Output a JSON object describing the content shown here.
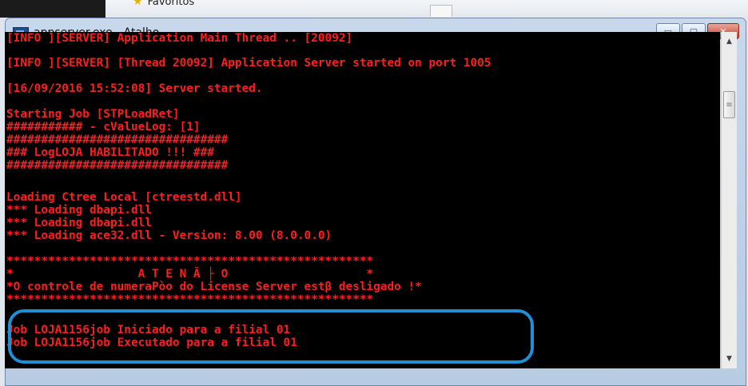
{
  "background": {
    "favorites_label": "Favoritos"
  },
  "window": {
    "title": "appserver.exe - Atalho",
    "controls": {
      "minimize": "▭",
      "maximize": "▢",
      "close": "✕"
    }
  },
  "console": {
    "lines": [
      "[INFO ][SERVER] Application Main Thread .. [20092]",
      "[INFO ][SERVER] [Thread 20092] Application Server started on port 1005",
      "[16/09/2016 15:52:08] Server started.",
      "Starting Job [STPLoadRet]",
      "########### - cValueLog: [1]",
      "################################",
      "### LogLOJA HABILITADO !!! ###",
      "################################",
      "Loading Ctree Local [ctreestd.dll]",
      "*** Loading dbapi.dll",
      "*** Loading dbapi.dll",
      "*** Loading ace32.dll - Version: 8.00 (8.0.0.0)",
      "*****************************************************",
      "*                  A T E N Ã ├ O                    *",
      "*O controle de numeraPòo do License Server estβ desligado !*",
      "*****************************************************",
      "Job LOJA1156job Iniciado para a filial 01",
      "Job LOJA1156job Executado para a filial 01"
    ]
  },
  "highlight_color": "#1f8fd6",
  "text_color": "#ff1e1e"
}
